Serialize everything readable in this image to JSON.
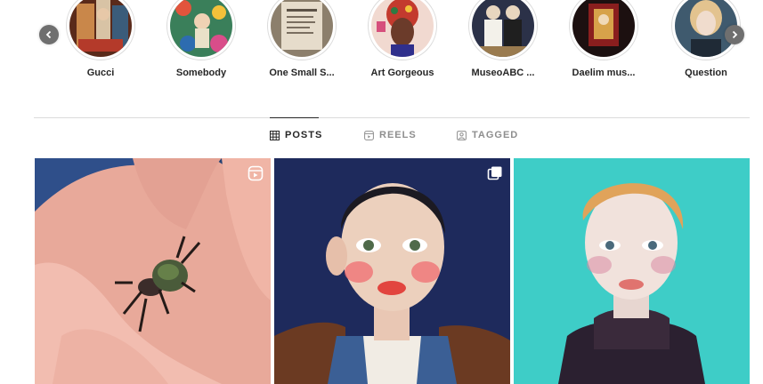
{
  "highlights": [
    {
      "label": "Gucci",
      "icon": "highlight-cover-gucci"
    },
    {
      "label": "Somebody",
      "icon": "highlight-cover-somebody"
    },
    {
      "label": "One Small S...",
      "icon": "highlight-cover-one-small"
    },
    {
      "label": "Art Gorgeous",
      "icon": "highlight-cover-art-gorgeous"
    },
    {
      "label": "MuseoABC ...",
      "icon": "highlight-cover-museoabc"
    },
    {
      "label": "Daelim mus...",
      "icon": "highlight-cover-daelim"
    },
    {
      "label": "Question",
      "icon": "highlight-cover-question"
    }
  ],
  "nav": {
    "prev_icon": "chevron-left-icon",
    "next_icon": "chevron-right-icon"
  },
  "tabs": [
    {
      "label": "POSTS",
      "icon": "grid-icon",
      "active": true
    },
    {
      "label": "REELS",
      "icon": "reels-icon",
      "active": false
    },
    {
      "label": "TAGGED",
      "icon": "tagged-icon",
      "active": false
    }
  ],
  "posts": [
    {
      "subject": "stag beetle in hand",
      "badge": "reel-icon"
    },
    {
      "subject": "portrait painting, dark-haired youth",
      "badge": "carousel-icon"
    },
    {
      "subject": "portrait painting, blond youth",
      "badge": ""
    }
  ],
  "colors": {
    "text": "#262626",
    "muted": "#8e8e8e",
    "border": "#dbdbdb"
  }
}
